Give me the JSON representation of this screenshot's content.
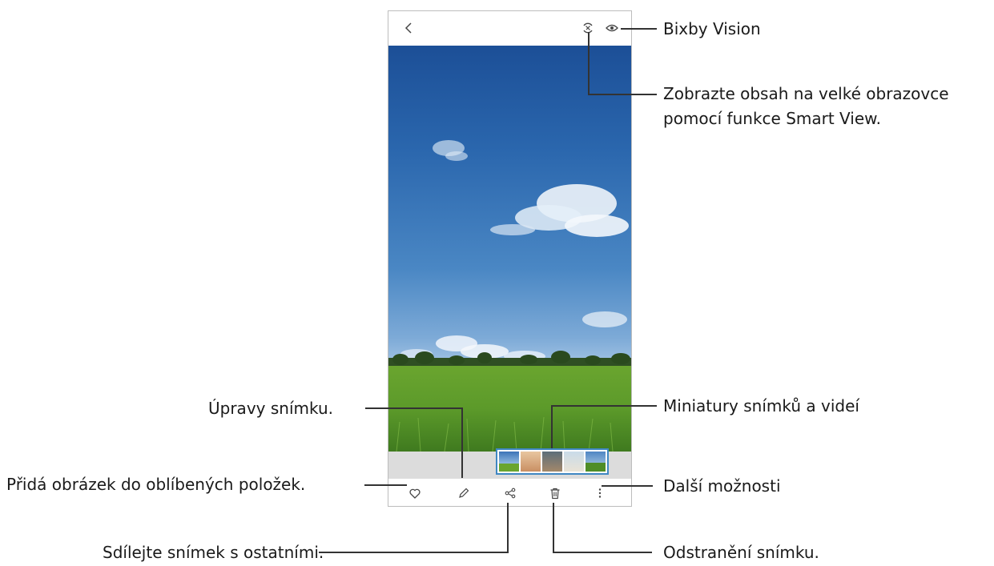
{
  "toolbar": {
    "back_icon": "chevron-left-icon",
    "smart_view_icon": "smart-view-icon",
    "bixby_vision_icon": "eye-icon"
  },
  "bottom_bar": {
    "favorite_icon": "heart-icon",
    "edit_icon": "pencil-icon",
    "share_icon": "share-icon",
    "delete_icon": "trash-icon",
    "more_icon": "more-vertical-icon"
  },
  "thumbnails": [
    "sky",
    "person",
    "couple",
    "family",
    "field"
  ],
  "callouts": {
    "bixby_vision": "Bixby Vision",
    "smart_view_line1": "Zobrazte obsah na velké obrazovce",
    "smart_view_line2": "pomocí funkce Smart View.",
    "thumbnails": "Miniatury snímků a videí",
    "more_options": "Další možnosti",
    "delete": "Odstranění snímku.",
    "edit": "Úpravy snímku.",
    "favorite": "Přidá obrázek do oblíbených položek.",
    "share": "Sdílejte snímek s ostatními."
  },
  "colors": {
    "accent": "#3f87c2",
    "sky_top": "#1c4f97",
    "grass": "#5c9a2a"
  }
}
